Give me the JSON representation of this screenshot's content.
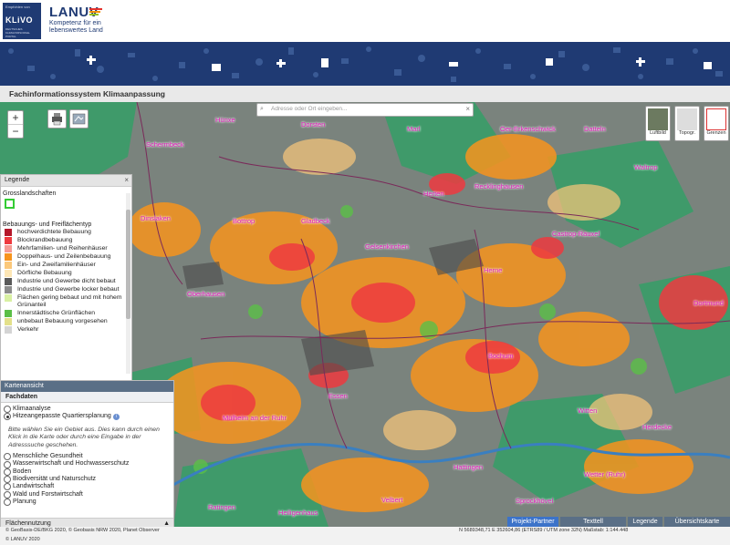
{
  "header": {
    "klivo_recommended": "Empfohlen von",
    "klivo_name": "KLiVO",
    "klivo_sub": "DEUTSCHES KLIMAVORSORGE-PORTAL",
    "lanuv_name": "LANUV",
    "lanuv_tagline": "Kompetenz für ein lebenswertes Land",
    "lanuv_bar_colors": [
      "#e5322d",
      "#f39200",
      "#95c11f",
      "#009fe3"
    ]
  },
  "app_title": "Fachinformationssystem Klimaanpassung",
  "map": {
    "zoom_in": "+",
    "zoom_out": "−",
    "search_placeholder": "Adresse oder Ort eingeben...",
    "basemaps": [
      "Luftbild",
      "Topogr.",
      "Grenzen"
    ],
    "places": [
      {
        "name": "Dorsten"
      },
      {
        "name": "Marl"
      },
      {
        "name": "Recklinghausen"
      },
      {
        "name": "Castrop-Rauxel"
      },
      {
        "name": "Herten"
      },
      {
        "name": "Gladbeck"
      },
      {
        "name": "Gelsenkirchen"
      },
      {
        "name": "Herne"
      },
      {
        "name": "Bottrop"
      },
      {
        "name": "Oberhausen"
      },
      {
        "name": "Bochum"
      },
      {
        "name": "Dortmund"
      },
      {
        "name": "Essen"
      },
      {
        "name": "Witten"
      },
      {
        "name": "Mülheim an der Ruhr"
      },
      {
        "name": "Hattingen"
      },
      {
        "name": "Velbert"
      },
      {
        "name": "Wetter (Ruhr)"
      },
      {
        "name": "Sprockhövel"
      },
      {
        "name": "Herdecke"
      },
      {
        "name": "Waltrop"
      },
      {
        "name": "Datteln"
      },
      {
        "name": "Oer-Erkenschwick"
      },
      {
        "name": "Hünxe"
      },
      {
        "name": "Dinslaken"
      },
      {
        "name": "Ratingen"
      },
      {
        "name": "Heiligenhaus"
      },
      {
        "name": "Schermbeck"
      }
    ]
  },
  "legend": {
    "title": "Legende",
    "section1": "Grosslandschaften",
    "section2": "Bebauungs- und Freiflächentyp",
    "items": [
      {
        "label": "hochverdichtete Bebauung",
        "color": "#b5182b"
      },
      {
        "label": "Blockrandbebauung",
        "color": "#ee3a3f"
      },
      {
        "label": "Mehrfamilien- und Reihenhäuser",
        "color": "#f59b94"
      },
      {
        "label": "Doppelhaus- und Zeilenbebauung",
        "color": "#f7941d"
      },
      {
        "label": "Ein- und Zweifamilienhäuser",
        "color": "#fbc87a"
      },
      {
        "label": "Dörfliche Bebauung",
        "color": "#fde6b5"
      },
      {
        "label": "Industrie und Gewerbe dicht bebaut",
        "color": "#5a5a5a"
      },
      {
        "label": "Industrie und Gewerbe locker bebaut",
        "color": "#8c8c8c"
      },
      {
        "label": "Flächen gering bebaut und mit hohem Grünanteil",
        "color": "#d9f0a3"
      },
      {
        "label": "Innerstädtische Grünflächen",
        "color": "#5bbf47"
      },
      {
        "label": "unbebaut Bebauung vorgesehen",
        "color": "#e3e08a"
      },
      {
        "label": "Verkehr",
        "color": "#d4d4d4"
      }
    ]
  },
  "kartenansicht": {
    "title": "Kartenansicht",
    "fachdaten": "Fachdaten",
    "options": [
      "Klimaanalyse",
      "Hitzeangepasste Quartiersplanung"
    ],
    "hint": "Bitte wählen Sie ein Gebiet aus. Dies kann durch einen Klick in die Karte oder durch eine Eingabe in der Adresssuche geschehen.",
    "themes": [
      "Menschliche Gesundheit",
      "Wasserwirtschaft und Hochwasserschutz",
      "Boden",
      "Biodiversität und Naturschutz",
      "Landwirtschaft",
      "Wald und Forstwirtschaft",
      "Planung"
    ],
    "flaechennutzung": "Flächennutzung"
  },
  "tabs": [
    "Projekt-Partner",
    "Texttell",
    "Legende",
    "Übersichtskarte"
  ],
  "footer": {
    "line1": "© GeoBasis-DE/BKG 2020, © Geobasis NRW 2020, Planet Observer",
    "line2": "© LANUV 2020",
    "coords": "N 5689348,71 E 352604,86 (ETRS89 / UTM zone 32N) Maßstab: 1:144.448"
  }
}
